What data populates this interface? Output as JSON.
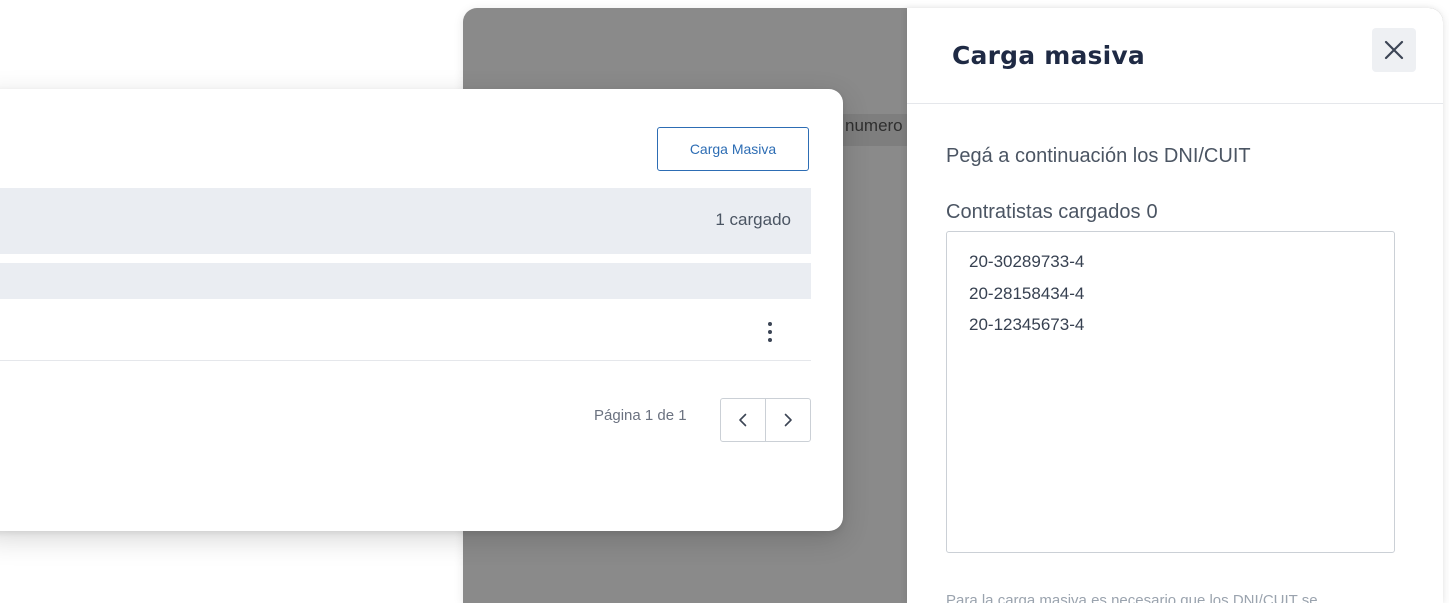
{
  "background": {
    "overlay_text": "numero"
  },
  "drawer": {
    "title": "Carga masiva",
    "close_icon": "close-icon",
    "instruction": "Pegá a continuación los DNI/CUIT",
    "count_label": "Contratistas cargados",
    "count_value": "0",
    "textarea_lines": [
      "20-30289733-4",
      "20-28158434-4",
      "20-12345673-4"
    ],
    "footnote": "Para la carga masiva es necesario que los DNI/CUIT se"
  },
  "card": {
    "bulk_button_label": "Carga Masiva",
    "loaded_status": "1 cargado",
    "row_menu_icon": "more-vertical-icon",
    "pagination": {
      "label": "Página 1 de 1",
      "prev_icon": "chevron-left-icon",
      "next_icon": "chevron-right-icon"
    }
  },
  "colors": {
    "accent": "#2d6db4",
    "title": "#1f2a44",
    "row_shade": "#eaedf2",
    "overlay": "#8a8a8a"
  }
}
